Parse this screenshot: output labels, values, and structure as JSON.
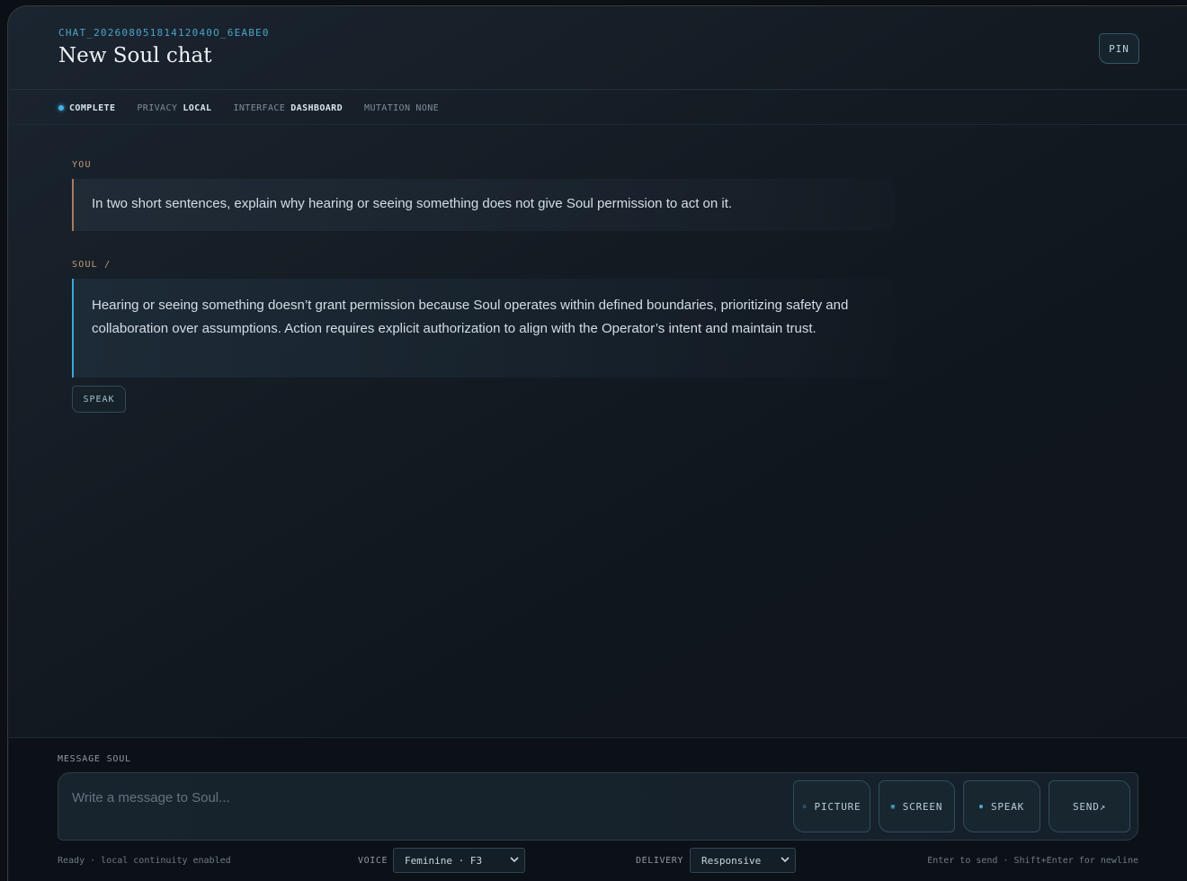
{
  "header": {
    "chat_id": "CHAT_20260805181412040O_6EABE0",
    "title": "New Soul chat",
    "pin_label": "PIN"
  },
  "status": {
    "state": "COMPLETE",
    "privacy_key": "PRIVACY",
    "privacy_value": "LOCAL",
    "interface_key": "INTERFACE",
    "interface_value": "DASHBOARD",
    "mutation_key": "MUTATION",
    "mutation_value": "NONE"
  },
  "messages": [
    {
      "role_label": "YOU",
      "text": "In two short sentences, explain why hearing or seeing something does not give Soul permission to act on it."
    },
    {
      "role_label": "SOUL /",
      "text": "Hearing or seeing something doesn’t grant permission because Soul operates within defined boundaries, prioritizing safety and collaboration over assumptions. Action requires explicit authorization to align with the Operator’s intent and maintain trust.",
      "speak_label": "SPEAK"
    }
  ],
  "composer": {
    "label": "MESSAGE SOUL",
    "placeholder": "Write a message to Soul...",
    "value": "",
    "buttons": {
      "picture": "PICTURE",
      "screen": "SCREEN",
      "speak": "SPEAK",
      "send": "SEND↗"
    },
    "status_text": "Ready · local continuity enabled",
    "voice_label": "VOICE",
    "voice_value": "Feminine · F3",
    "delivery_label": "DELIVERY",
    "delivery_value": "Responsive",
    "hint": "Enter to send · Shift+Enter for newline"
  },
  "colors": {
    "accent": "#42b4e8",
    "user_accent": "#a77c5e",
    "label_user": "#c39a78"
  }
}
